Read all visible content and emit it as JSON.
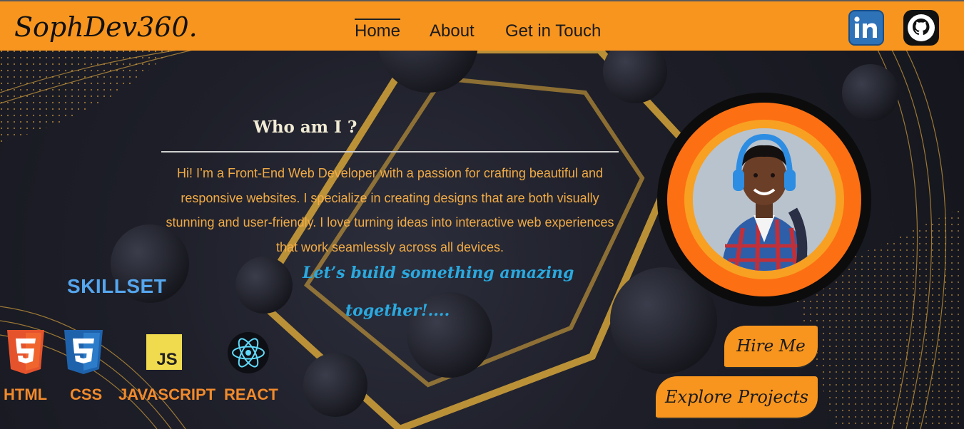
{
  "nav": {
    "logo": "SophDev360.",
    "links": [
      "Home",
      "About",
      "Get in Touch"
    ],
    "active": "Home",
    "social": [
      "linkedin-icon",
      "github-icon"
    ]
  },
  "about": {
    "heading": "Who am I ?",
    "body": "Hi! I’m a Front-End Web Developer with a passion for crafting beautiful and responsive websites. I specialize in creating designs that are both visually stunning and user-friendly. I love turning ideas into interactive web experiences that work seamlessly across all devices.",
    "tagline_line1": "Let’s build something amazing",
    "tagline_line2": "together!...."
  },
  "skills": {
    "title": "SKILLSET",
    "items": [
      {
        "label": "HTML",
        "icon": "html5-icon"
      },
      {
        "label": "CSS",
        "icon": "css3-icon"
      },
      {
        "label": "JAVASCRIPT",
        "icon": "javascript-icon"
      },
      {
        "label": "REACT",
        "icon": "react-icon"
      }
    ]
  },
  "cta": {
    "hire": "Hire Me",
    "explore": "Explore Projects"
  },
  "colors": {
    "accent": "#f7951f",
    "text_orange": "#f1ab45",
    "tagline_blue": "#2aa9df",
    "skill_label": "#f28a2b"
  }
}
